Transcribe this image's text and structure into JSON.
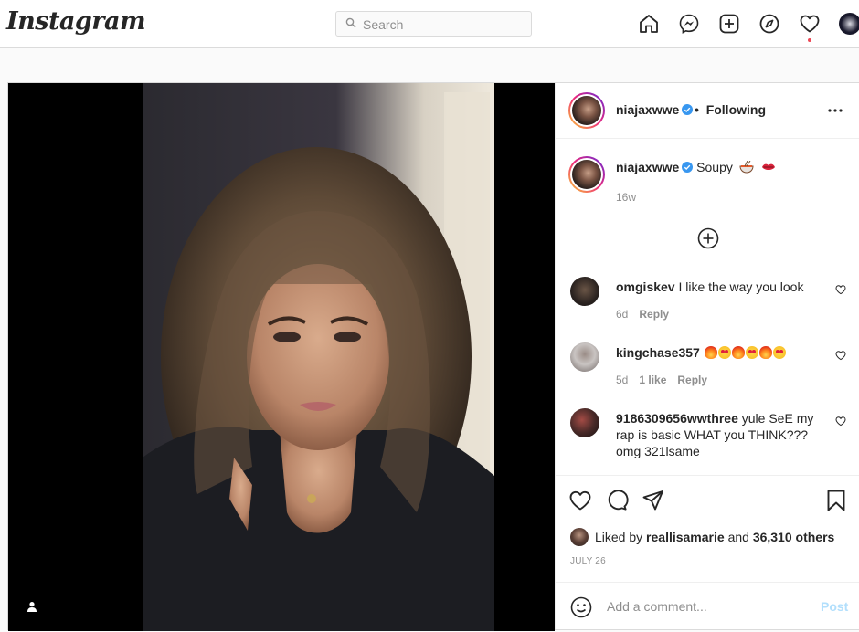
{
  "app": {
    "logo": "Instagram"
  },
  "search": {
    "placeholder": "Search"
  },
  "nav": {
    "icons": [
      "home-icon",
      "messenger-icon",
      "new-post-icon",
      "explore-icon",
      "activity-heart-icon",
      "profile-avatar"
    ]
  },
  "post": {
    "author": "niajaxwwe",
    "follow_separator": "•",
    "follow_status": "Following",
    "caption": {
      "username": "niajaxwwe",
      "text": "Soupy",
      "emojis": [
        "ramen-emoji",
        "lips-emoji"
      ],
      "time": "16w"
    },
    "comments": [
      {
        "username": "omgiskev",
        "text": "I like the way you look",
        "time": "6d",
        "likes": "",
        "reply": "Reply"
      },
      {
        "username": "kingchase357",
        "text": "",
        "emojis": [
          "fire",
          "heart-eyes",
          "fire",
          "heart-eyes",
          "fire",
          "heart-eyes"
        ],
        "time": "5d",
        "likes": "1 like",
        "reply": "Reply"
      },
      {
        "username": "9186309656wwthree",
        "text": "yule SeE my rap is basic WHAT you THINK??? omg 321lsame",
        "time": "",
        "likes": "",
        "reply": ""
      }
    ],
    "liked_by_prefix": "Liked by",
    "liked_by_user": "reallisamarie",
    "liked_by_and": "and",
    "liked_by_count": "36,310 others",
    "date": "JULY 26",
    "add_comment_placeholder": "Add a comment...",
    "post_button": "Post"
  },
  "colors": {
    "accent": "#0095f6",
    "post_button_disabled": "#b2dffc",
    "verified": "#3897f0",
    "notification_dot": "#ed4956",
    "border": "#dbdbdb"
  }
}
